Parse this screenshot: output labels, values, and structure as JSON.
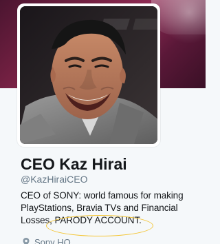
{
  "profile": {
    "display_name": "CEO Kaz Hirai",
    "handle": "@KazHiraiCEO",
    "bio_lines": [
      "CEO of SONY: world famous for making",
      "PlayStations, Bravia TVs and Financial",
      "Losses, PARODY ACCOUNT."
    ],
    "location": "Sony HQ",
    "avatar_icon": "profile-photo-icon",
    "location_icon": "location-pin-icon"
  },
  "colors": {
    "banner": "#7a2245",
    "highlight_ellipse": "#f4c430",
    "text": "#14171a",
    "muted": "#657786",
    "background": "#f5f8fa"
  }
}
